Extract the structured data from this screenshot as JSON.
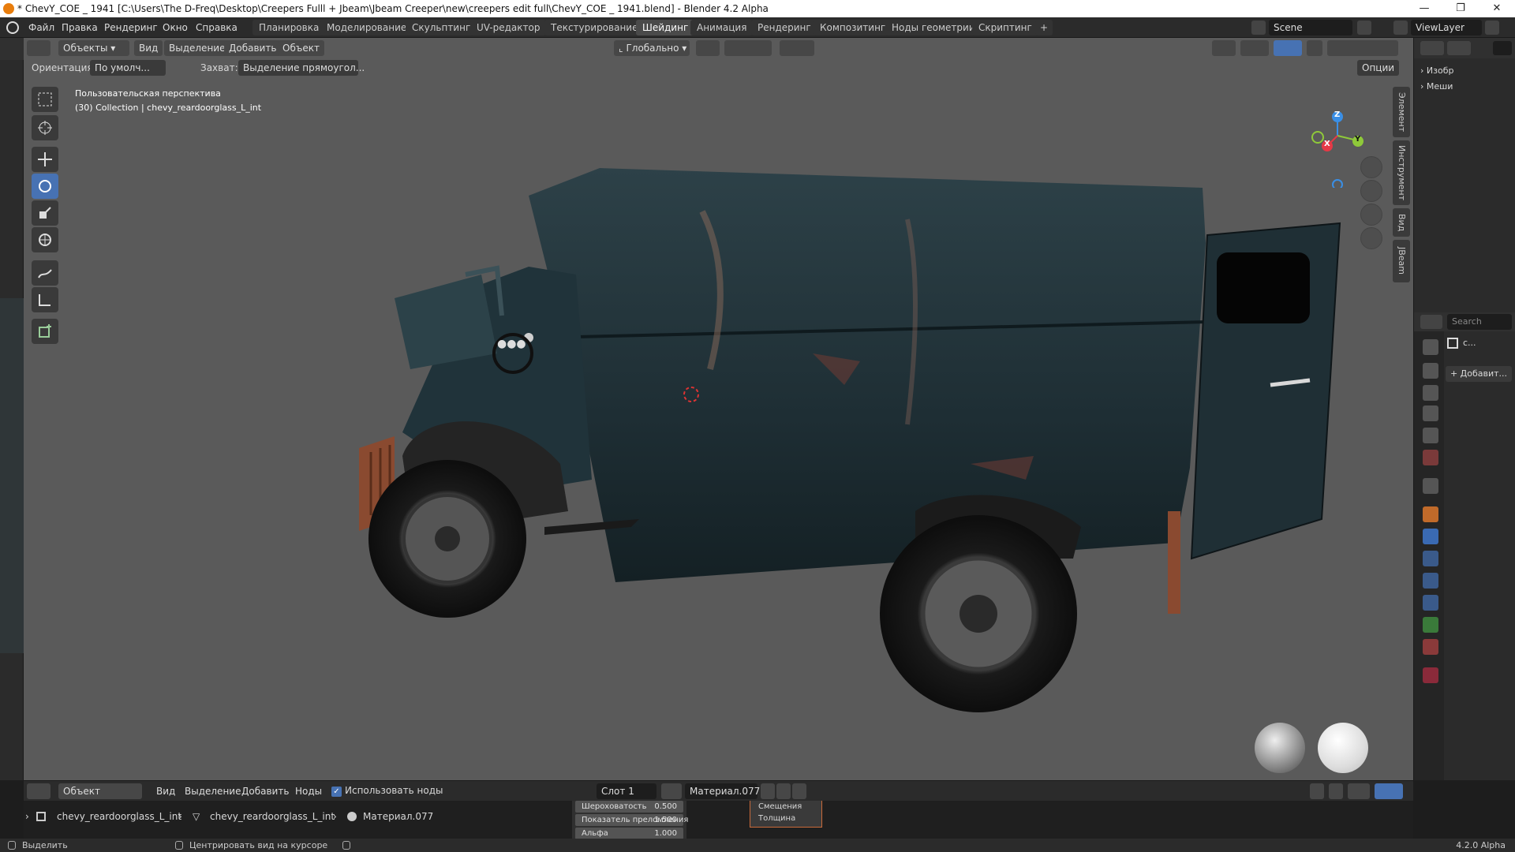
{
  "window": {
    "title": "* ChevY_COE _ 1941 [C:\\Users\\The D-Freq\\Desktop\\Creepers Fulll + Jbeam\\Jbeam Creeper\\new\\creepers edit full\\ChevY_COE _ 1941.blend] - Blender 4.2 Alpha",
    "minimize": "—",
    "maximize": "❐",
    "close": "✕"
  },
  "menu": [
    "Файл",
    "Правка",
    "Рендеринг",
    "Окно",
    "Справка"
  ],
  "workspaces": [
    "Планировка",
    "Моделирование",
    "Скульптинг",
    "UV-редактор",
    "Текстурирование",
    "Шейдинг",
    "Анимация",
    "Рендеринг",
    "Композитинг",
    "Ноды геометрии",
    "Скриптинг"
  ],
  "active_workspace": "Шейдинг",
  "add_workspace": "+",
  "scene": "Scene",
  "view_layer": "ViewLayer",
  "viewport_header": {
    "mode": "Объекты",
    "view": "Вид",
    "select": "Выделение",
    "add": "Добавить",
    "object": "Объект",
    "transform": "Глобально",
    "options": "Опции"
  },
  "tool_settings": {
    "orientation_label": "Ориентация:",
    "orientation_value": "По умолч...",
    "snap_label": "Захват:",
    "snap_value": "Выделение прямоугол..."
  },
  "viewport_info": {
    "line1": "Пользовательская перспектива",
    "line2": "(30) Collection | chevy_reardoorglass_L_int"
  },
  "gizmo": {
    "x": "X",
    "y": "Y",
    "z": "Z"
  },
  "sidebar_tabs": [
    "Элемент",
    "Инструмент",
    "Вид",
    "JBeam"
  ],
  "outliner": {
    "items": [
      "Изобр",
      "Меши"
    ]
  },
  "properties": {
    "search_placeholder": "Search",
    "object_short": "c...",
    "add_button": "+ Добавит..."
  },
  "node_editor_header": {
    "mode": "Объект",
    "view": "Вид",
    "select": "Выделение",
    "add": "Добавить",
    "node": "Ноды",
    "use_nodes": "Использовать ноды",
    "slot": "Слот 1",
    "material": "Материал.077"
  },
  "node_fields": [
    {
      "label": "Шероховатость",
      "value": "0.500"
    },
    {
      "label": "Показатель преломления",
      "value": "1.500"
    },
    {
      "label": "Альфа",
      "value": "1.000"
    }
  ],
  "node_sockets": [
    "Смещения",
    "Толщина"
  ],
  "breadcrumb": {
    "object": "chevy_reardoorglass_L_int",
    "mesh": "chevy_reardoorglass_L_int",
    "material": "Материал.077"
  },
  "statusbar": {
    "select": "Выделить",
    "center": "Центрировать вид на курсоре",
    "version": "4.2.0 Alpha"
  },
  "colors": {
    "accent": "#4772b3",
    "viewport_bg": "#5a5a5a",
    "panel_bg": "#2b2b2b",
    "x_axis": "#e63946",
    "y_axis": "#8fc93a",
    "z_axis": "#3a8fe6"
  }
}
